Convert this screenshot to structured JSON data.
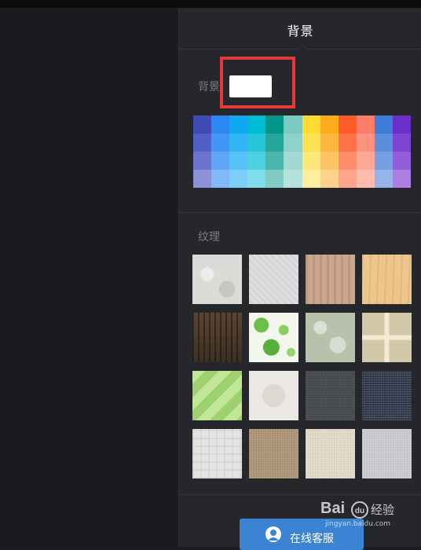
{
  "panel": {
    "title": "背景",
    "background_label": "背景",
    "background_color": "#ffffff",
    "texture_label": "纹理"
  },
  "palette": [
    [
      "#3f4ab4",
      "#2d86f4",
      "#0fa8f1",
      "#00bcd4",
      "#009688",
      "#7bc9c3",
      "#fddb30",
      "#fdab1a",
      "#ff5b28",
      "#ff7e6a",
      "#3e7cd9",
      "#6b2ec9"
    ],
    [
      "#5060c4",
      "#4496f6",
      "#35b6f4",
      "#26c6da",
      "#26a69a",
      "#8fd1cb",
      "#fde256",
      "#fdb73f",
      "#ff724a",
      "#ff9380",
      "#5b8fde",
      "#7e45d1"
    ],
    [
      "#6a76cc",
      "#5fa6f7",
      "#56c2f6",
      "#4dd0e1",
      "#4db6ac",
      "#a3d9d4",
      "#fee87a",
      "#fdc466",
      "#ff8a6c",
      "#ffa796",
      "#779fe3",
      "#935ed9"
    ],
    [
      "#8b93d6",
      "#81b8f9",
      "#7ccff8",
      "#80deea",
      "#80cbc4",
      "#b7e1dd",
      "#ffee9d",
      "#fdd28d",
      "#ffa48d",
      "#ffbcaf",
      "#95b4ea",
      "#ab80e2"
    ]
  ],
  "textures": [
    {
      "name": "white-stone-texture",
      "color": "#dcdbd7"
    },
    {
      "name": "light-gray-paper-texture",
      "color": "#d6d5d8"
    },
    {
      "name": "light-oak-wood-texture",
      "color": "#c9a88e"
    },
    {
      "name": "maple-wood-texture",
      "color": "#ecc68c"
    },
    {
      "name": "dark-wood-texture",
      "color": "#4c3a2c"
    },
    {
      "name": "green-dots-texture",
      "color": "#f2f7ee"
    },
    {
      "name": "sage-leaf-pattern-texture",
      "color": "#b8c1ab"
    },
    {
      "name": "beige-brick-texture",
      "color": "#d2c7a6"
    },
    {
      "name": "lime-green-pattern-texture",
      "color": "#9fd070"
    },
    {
      "name": "white-emboss-texture",
      "color": "#ece9e4"
    },
    {
      "name": "dark-gray-fabric-texture",
      "color": "#4a4d50"
    },
    {
      "name": "navy-knit-texture",
      "color": "#2e3644"
    },
    {
      "name": "white-linen-check-texture",
      "color": "#e6e4e3"
    },
    {
      "name": "burlap-texture",
      "color": "#b39b7f"
    },
    {
      "name": "cream-canvas-texture",
      "color": "#e4ddcc"
    },
    {
      "name": "light-gray-linen-texture",
      "color": "#cfcfd2"
    }
  ],
  "service_button": {
    "label": "在线客服",
    "icon": "user-icon"
  },
  "watermark": {
    "brand_left": "Bai",
    "brand_right": "经验",
    "brand_suffix": "du",
    "url": "jingyan.baidu.com"
  }
}
